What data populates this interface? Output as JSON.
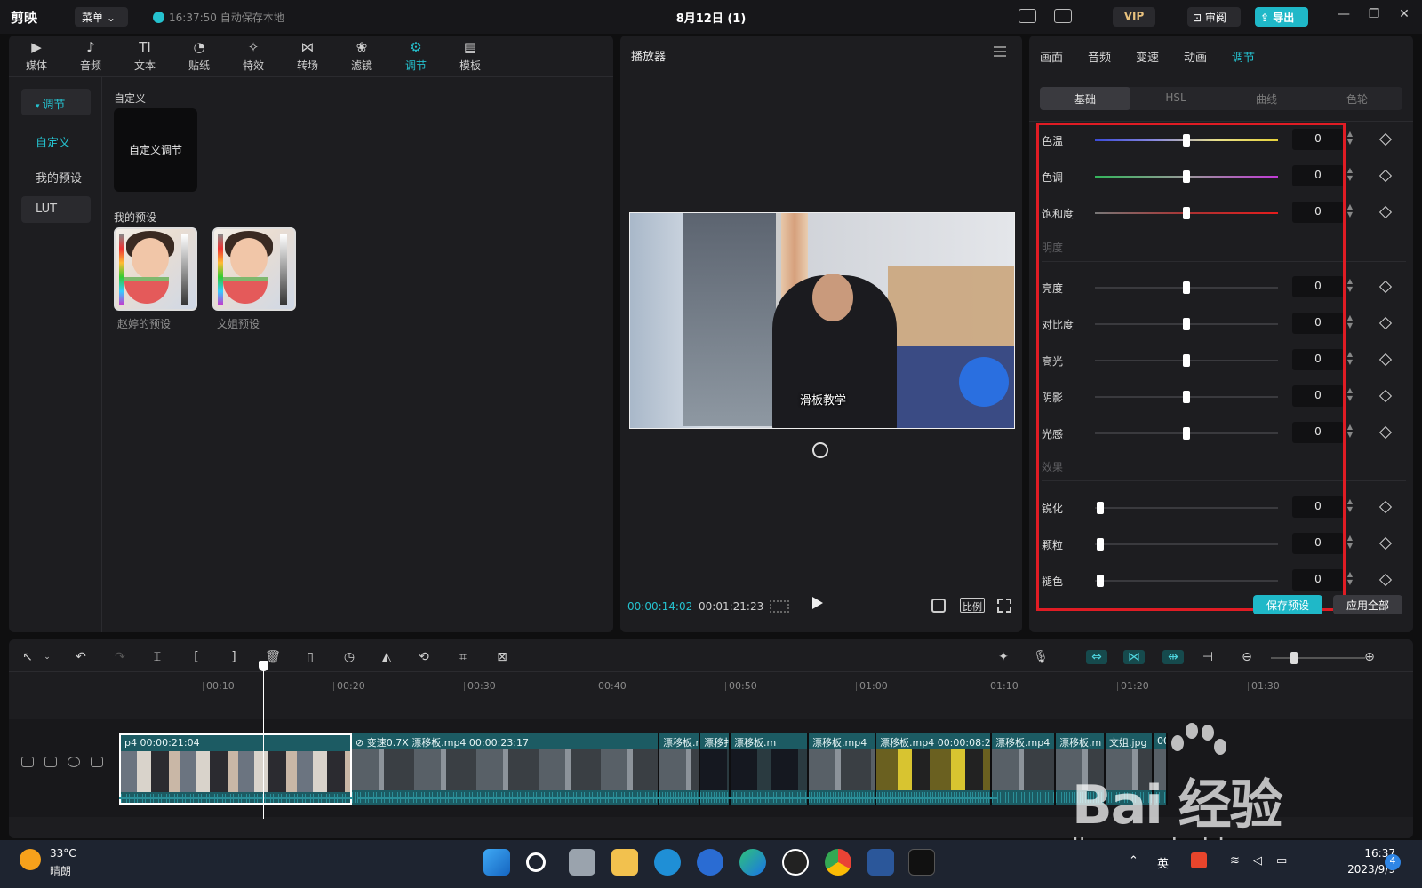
{
  "titlebar": {
    "logo": "剪映",
    "menu_label": "菜单",
    "save_status": "16:37:50 自动保存本地",
    "doc_title": "8月12日 (1)",
    "vip_label": "VIP",
    "review_label": "审阅",
    "export_label": "导出",
    "minimize": "—",
    "maximize": "❐",
    "close": "✕"
  },
  "media_tools": [
    {
      "label": "媒体",
      "icon": "media-icon",
      "glyph": "▶"
    },
    {
      "label": "音频",
      "icon": "audio-icon",
      "glyph": "♪"
    },
    {
      "label": "文本",
      "icon": "text-icon",
      "glyph": "TI"
    },
    {
      "label": "贴纸",
      "icon": "sticker-icon",
      "glyph": "◔"
    },
    {
      "label": "特效",
      "icon": "effects-icon",
      "glyph": "✧"
    },
    {
      "label": "转场",
      "icon": "transition-icon",
      "glyph": "⋈"
    },
    {
      "label": "滤镜",
      "icon": "filter-icon",
      "glyph": "❀"
    },
    {
      "label": "调节",
      "icon": "adjust-icon",
      "glyph": "⚙"
    },
    {
      "label": "模板",
      "icon": "template-icon",
      "glyph": "▤"
    }
  ],
  "media_side": {
    "adjust": "调节",
    "custom": "自定义",
    "my_presets": "我的预设",
    "lut": "LUT"
  },
  "media_content": {
    "custom_section": "自定义",
    "custom_card": "自定义调节",
    "preset_section": "我的预设",
    "presets": [
      "赵婷的预设",
      "文姐预设"
    ]
  },
  "player": {
    "title": "播放器",
    "subtitle": "滑板教学",
    "time_current": "00:00:14:02",
    "time_total": "00:01:21:23",
    "ratio_label": "比例"
  },
  "props": {
    "tabs": [
      "画面",
      "音频",
      "变速",
      "动画",
      "调节"
    ],
    "subtabs": [
      "基础",
      "HSL",
      "曲线",
      "色轮"
    ],
    "color_rows": [
      {
        "label": "色温",
        "value": "0",
        "level": 0.5
      },
      {
        "label": "色调",
        "value": "0",
        "level": 0.5
      },
      {
        "label": "饱和度",
        "value": "0",
        "level": 0.5
      }
    ],
    "light_group": "明度",
    "light_rows": [
      {
        "label": "亮度",
        "value": "0",
        "level": 0.5
      },
      {
        "label": "对比度",
        "value": "0",
        "level": 0.5
      },
      {
        "label": "高光",
        "value": "0",
        "level": 0.5
      },
      {
        "label": "阴影",
        "value": "0",
        "level": 0.5
      },
      {
        "label": "光感",
        "value": "0",
        "level": 0.5
      }
    ],
    "effect_group": "效果",
    "effect_rows": [
      {
        "label": "锐化",
        "value": "0",
        "level": 0
      },
      {
        "label": "颗粒",
        "value": "0",
        "level": 0
      },
      {
        "label": "褪色",
        "value": "0",
        "level": 0
      }
    ],
    "save_preset": "保存预设",
    "apply_all": "应用全部"
  },
  "timeline": {
    "ticks": [
      "00:10",
      "00:20",
      "00:30",
      "00:40",
      "00:50",
      "01:00",
      "01:10",
      "01:20",
      "01:30"
    ],
    "clips": [
      {
        "label": "p4  00:00:21:04",
        "style": "indoor"
      },
      {
        "label": "⊘ 变速0.7X  漂移板.mp4  00:00:23:17",
        "style": "street"
      },
      {
        "label": "漂移板.r",
        "style": "street"
      },
      {
        "label": "漂移扌",
        "style": "dark"
      },
      {
        "label": "漂移板.m",
        "style": "dark"
      },
      {
        "label": "漂移板.mp4",
        "style": "street"
      },
      {
        "label": "漂移板.mp4  00:00:08:2",
        "style": "yellow"
      },
      {
        "label": "漂移板.mp4",
        "style": "street"
      },
      {
        "label": "漂移板.m",
        "style": "street"
      },
      {
        "label": "文姐.jpg",
        "style": "street"
      },
      {
        "label": "00:",
        "style": "street"
      }
    ]
  },
  "watermark": {
    "brand": "Bai 经验",
    "url": "jingyan.baidu.com"
  },
  "taskbar": {
    "temp": "33°C",
    "weather": "晴朗",
    "ime": "英",
    "time": "16:37",
    "date": "2023/9/9",
    "notifications": "4"
  },
  "colors": {
    "accent": "#25c2cf",
    "highlight": "#e01c24"
  }
}
